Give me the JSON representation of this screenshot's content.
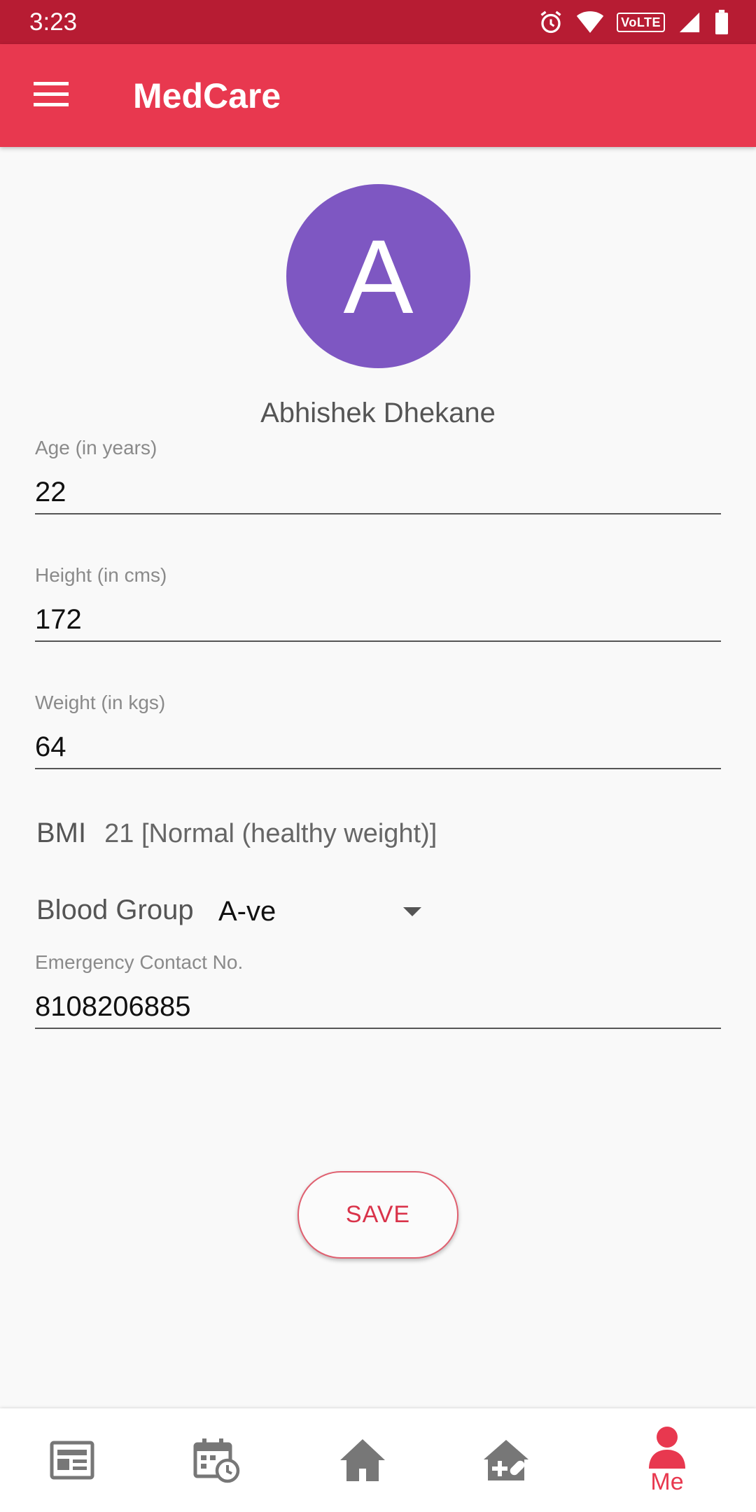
{
  "status_bar": {
    "time": "3:23",
    "volte": "VoLTE",
    "icons": [
      "alarm-icon",
      "wifi-icon",
      "volte-icon",
      "signal-icon",
      "battery-icon"
    ]
  },
  "app_bar": {
    "title": "MedCare",
    "menu_icon": "menu-icon"
  },
  "profile": {
    "avatar_letter": "A",
    "avatar_color": "#7e57c2",
    "name": "Abhishek Dhekane"
  },
  "fields": {
    "age": {
      "label": "Age (in years)",
      "value": "22"
    },
    "height": {
      "label": "Height (in cms)",
      "value": "172"
    },
    "weight": {
      "label": "Weight (in kgs)",
      "value": "64"
    },
    "emergency": {
      "label": "Emergency Contact No.",
      "value": "8108206885"
    }
  },
  "bmi": {
    "label": "BMI",
    "value": "21 [Normal (healthy weight)]"
  },
  "blood_group": {
    "label": "Blood Group",
    "selected": "A-ve"
  },
  "save_label": "SAVE",
  "bottom_nav": {
    "items": [
      {
        "icon": "news-icon",
        "label": ""
      },
      {
        "icon": "calendar-clock-icon",
        "label": ""
      },
      {
        "icon": "home-icon",
        "label": ""
      },
      {
        "icon": "pharmacy-icon",
        "label": ""
      },
      {
        "icon": "person-icon",
        "label": "Me"
      }
    ],
    "active_index": 4
  },
  "colors": {
    "status_bar": "#b71c33",
    "app_bar": "#e8384f",
    "accent": "#d9334a",
    "nav_inactive": "#777777"
  }
}
